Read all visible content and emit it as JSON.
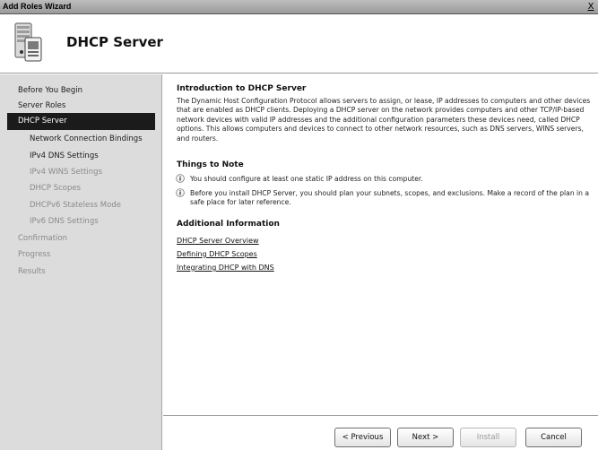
{
  "window": {
    "title": "Add Roles Wizard",
    "close_glyph": "X"
  },
  "header": {
    "title": "DHCP Server",
    "icon": "dhcp-server-icon"
  },
  "sidebar": {
    "items": [
      {
        "label": "Before You Begin",
        "level": 0,
        "state": "normal"
      },
      {
        "label": "Server Roles",
        "level": 0,
        "state": "normal"
      },
      {
        "label": "DHCP Server",
        "level": 0,
        "state": "active"
      },
      {
        "label": "Network Connection Bindings",
        "level": 1,
        "state": "normal"
      },
      {
        "label": "IPv4 DNS Settings",
        "level": 1,
        "state": "normal"
      },
      {
        "label": "IPv4 WINS Settings",
        "level": 1,
        "state": "disabled"
      },
      {
        "label": "DHCP Scopes",
        "level": 1,
        "state": "disabled"
      },
      {
        "label": "DHCPv6 Stateless Mode",
        "level": 1,
        "state": "disabled"
      },
      {
        "label": "IPv6 DNS Settings",
        "level": 1,
        "state": "disabled"
      },
      {
        "label": "Confirmation",
        "level": 0,
        "state": "disabled"
      },
      {
        "label": "Progress",
        "level": 0,
        "state": "disabled"
      },
      {
        "label": "Results",
        "level": 0,
        "state": "disabled"
      }
    ]
  },
  "content": {
    "intro_title": "Introduction to DHCP Server",
    "intro_text": "The Dynamic Host Configuration Protocol allows servers to assign, or lease, IP addresses to computers and other devices that are enabled as DHCP clients. Deploying a DHCP server on the network provides computers and other TCP/IP-based network devices with valid IP addresses and the additional configuration parameters these devices need, called DHCP options. This allows computers and devices to connect to other network resources, such as DNS servers, WINS servers, and routers.",
    "notes_title": "Things to Note",
    "notes": [
      "You should configure at least one static IP address on this computer.",
      "Before you install DHCP Server, you should plan your subnets, scopes, and exclusions. Make a record of the plan in a safe place for later reference."
    ],
    "info_title": "Additional Information",
    "links": [
      "DHCP Server Overview",
      "Defining DHCP Scopes",
      "Integrating DHCP with DNS"
    ]
  },
  "footer": {
    "previous": "< Previous",
    "next": "Next >",
    "install": "Install",
    "cancel": "Cancel"
  }
}
